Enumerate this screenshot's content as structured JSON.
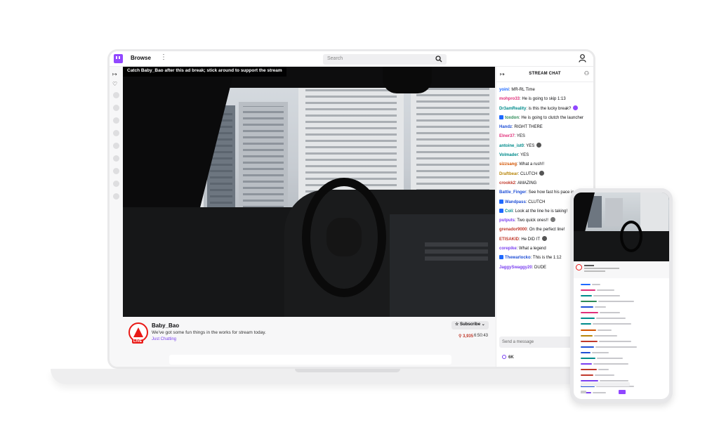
{
  "topbar": {
    "browse_label": "Browse",
    "menu_glyph": "⋮",
    "search_placeholder": "Search"
  },
  "rail": {
    "items": [
      {
        "icon": "expand-icon",
        "glyph": "↦"
      },
      {
        "icon": "heart-icon",
        "glyph": "♡"
      }
    ]
  },
  "video": {
    "notice": "Catch Baby_Bao after this ad break; stick around to support the stream"
  },
  "channel": {
    "name": "Baby_Bao",
    "title": "We've got some fun things in the works for stream today.",
    "category": "Just Chatting",
    "live_badge": "LIVE",
    "subscribe_label": "Subscribe",
    "viewers": "3,935",
    "uptime": "6:50:43"
  },
  "chat": {
    "header": "STREAM CHAT",
    "input_placeholder": "Send a message",
    "points": "6K",
    "messages": [
      {
        "user": "yoini",
        "text": "MR-RL Time",
        "color": "#1f69ff",
        "badge": false,
        "emote": ""
      },
      {
        "user": "mohpro33",
        "text": "He is going to skip 1:13",
        "color": "#e0307a",
        "badge": false,
        "emote": ""
      },
      {
        "user": "Dr3amReality",
        "text": "is this the lucky break?",
        "color": "#008b8b",
        "badge": false,
        "emote": "#9147ff"
      },
      {
        "user": "toxdon",
        "text": "He is going to clutch the launcher",
        "color": "#2e8b57",
        "badge": true,
        "emote": ""
      },
      {
        "user": "Handz",
        "text": "RIGHT THERE",
        "color": "#1f4fd6",
        "badge": false,
        "emote": ""
      },
      {
        "user": "Elner37",
        "text": "YES",
        "color": "#e0307a",
        "badge": false,
        "emote": ""
      },
      {
        "user": "antoine_ist0",
        "text": "YES",
        "color": "#008b8b",
        "badge": false,
        "emote": "#555555"
      },
      {
        "user": "Volmader",
        "text": "YES",
        "color": "#008b8b",
        "badge": false,
        "emote": ""
      },
      {
        "user": "sizzsang",
        "text": "What a rush!!",
        "color": "#d35400",
        "badge": false,
        "emote": ""
      },
      {
        "user": "Draftbear",
        "text": "CLUTCH",
        "color": "#b8860b",
        "badge": false,
        "emote": "#555555"
      },
      {
        "user": "crookk2",
        "text": "AMAZING",
        "color": "#c0392b",
        "badge": false,
        "emote": ""
      },
      {
        "user": "Battle_Finger",
        "text": "See how fast his pace is",
        "color": "#1f4fd6",
        "badge": false,
        "emote": ""
      },
      {
        "user": "Wandpass",
        "text": "CLUTCH",
        "color": "#1f4fd6",
        "badge": true,
        "emote": ""
      },
      {
        "user": "Coli",
        "text": "Look at the line he is taking!",
        "color": "#008b8b",
        "badge": true,
        "emote": ""
      },
      {
        "user": "putputs",
        "text": "Two quick ones!!",
        "color": "#7a3ff0",
        "badge": false,
        "emote": "#777777"
      },
      {
        "user": "grenador9000",
        "text": "On the perfect line!",
        "color": "#c0392b",
        "badge": false,
        "emote": ""
      },
      {
        "user": "ETISAKID",
        "text": "He DID IT",
        "color": "#c0392b",
        "badge": false,
        "emote": "#555555"
      },
      {
        "user": "corepike",
        "text": "What a legend",
        "color": "#7a3ff0",
        "badge": false,
        "emote": ""
      },
      {
        "user": "Thewarlocko",
        "text": "This is the 1:12",
        "color": "#1f4fd6",
        "badge": true,
        "emote": ""
      },
      {
        "user": "JaggySwaggy20",
        "text": "DUDE",
        "color": "#7a3ff0",
        "badge": false,
        "emote": ""
      }
    ]
  },
  "phone": {
    "chat_line_colors": [
      "#1f69ff",
      "#e0307a",
      "#008b8b",
      "#2e8b57",
      "#1f4fd6",
      "#e0307a",
      "#008b8b",
      "#008b8b",
      "#d35400",
      "#b8860b",
      "#c0392b",
      "#1f4fd6",
      "#1f4fd6",
      "#008b8b",
      "#7a3ff0",
      "#c0392b",
      "#c0392b",
      "#7a3ff0",
      "#1f4fd6",
      "#7a3ff0"
    ]
  },
  "colors": {
    "accent": "#9147ff",
    "live": "#e91916"
  }
}
